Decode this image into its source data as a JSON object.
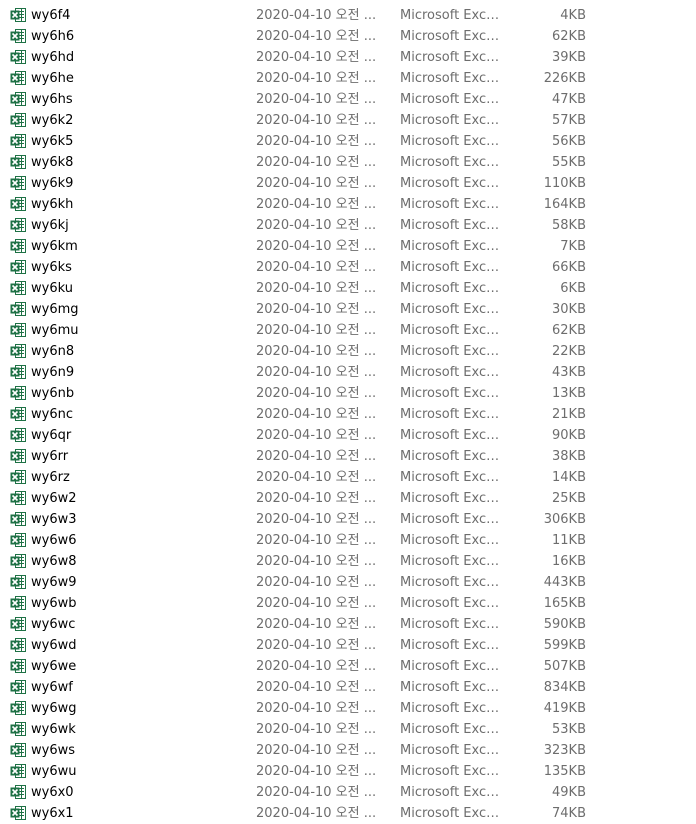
{
  "icon": "excel-file-icon",
  "colors": {
    "excel_green": "#1e7145",
    "secondary_text": "#6d6d6d"
  },
  "files": [
    {
      "name": "wy6f4",
      "date": "2020-04-10 오전 ...",
      "type": "Microsoft Excel...",
      "size": "4KB"
    },
    {
      "name": "wy6h6",
      "date": "2020-04-10 오전 ...",
      "type": "Microsoft Excel...",
      "size": "62KB"
    },
    {
      "name": "wy6hd",
      "date": "2020-04-10 오전 ...",
      "type": "Microsoft Excel...",
      "size": "39KB"
    },
    {
      "name": "wy6he",
      "date": "2020-04-10 오전 ...",
      "type": "Microsoft Excel...",
      "size": "226KB"
    },
    {
      "name": "wy6hs",
      "date": "2020-04-10 오전 ...",
      "type": "Microsoft Excel...",
      "size": "47KB"
    },
    {
      "name": "wy6k2",
      "date": "2020-04-10 오전 ...",
      "type": "Microsoft Excel...",
      "size": "57KB"
    },
    {
      "name": "wy6k5",
      "date": "2020-04-10 오전 ...",
      "type": "Microsoft Excel...",
      "size": "56KB"
    },
    {
      "name": "wy6k8",
      "date": "2020-04-10 오전 ...",
      "type": "Microsoft Excel...",
      "size": "55KB"
    },
    {
      "name": "wy6k9",
      "date": "2020-04-10 오전 ...",
      "type": "Microsoft Excel...",
      "size": "110KB"
    },
    {
      "name": "wy6kh",
      "date": "2020-04-10 오전 ...",
      "type": "Microsoft Excel...",
      "size": "164KB"
    },
    {
      "name": "wy6kj",
      "date": "2020-04-10 오전 ...",
      "type": "Microsoft Excel...",
      "size": "58KB"
    },
    {
      "name": "wy6km",
      "date": "2020-04-10 오전 ...",
      "type": "Microsoft Excel...",
      "size": "7KB"
    },
    {
      "name": "wy6ks",
      "date": "2020-04-10 오전 ...",
      "type": "Microsoft Excel...",
      "size": "66KB"
    },
    {
      "name": "wy6ku",
      "date": "2020-04-10 오전 ...",
      "type": "Microsoft Excel...",
      "size": "6KB"
    },
    {
      "name": "wy6mg",
      "date": "2020-04-10 오전 ...",
      "type": "Microsoft Excel...",
      "size": "30KB"
    },
    {
      "name": "wy6mu",
      "date": "2020-04-10 오전 ...",
      "type": "Microsoft Excel...",
      "size": "62KB"
    },
    {
      "name": "wy6n8",
      "date": "2020-04-10 오전 ...",
      "type": "Microsoft Excel...",
      "size": "22KB"
    },
    {
      "name": "wy6n9",
      "date": "2020-04-10 오전 ...",
      "type": "Microsoft Excel...",
      "size": "43KB"
    },
    {
      "name": "wy6nb",
      "date": "2020-04-10 오전 ...",
      "type": "Microsoft Excel...",
      "size": "13KB"
    },
    {
      "name": "wy6nc",
      "date": "2020-04-10 오전 ...",
      "type": "Microsoft Excel...",
      "size": "21KB"
    },
    {
      "name": "wy6qr",
      "date": "2020-04-10 오전 ...",
      "type": "Microsoft Excel...",
      "size": "90KB"
    },
    {
      "name": "wy6rr",
      "date": "2020-04-10 오전 ...",
      "type": "Microsoft Excel...",
      "size": "38KB"
    },
    {
      "name": "wy6rz",
      "date": "2020-04-10 오전 ...",
      "type": "Microsoft Excel...",
      "size": "14KB"
    },
    {
      "name": "wy6w2",
      "date": "2020-04-10 오전 ...",
      "type": "Microsoft Excel...",
      "size": "25KB"
    },
    {
      "name": "wy6w3",
      "date": "2020-04-10 오전 ...",
      "type": "Microsoft Excel...",
      "size": "306KB"
    },
    {
      "name": "wy6w6",
      "date": "2020-04-10 오전 ...",
      "type": "Microsoft Excel...",
      "size": "11KB"
    },
    {
      "name": "wy6w8",
      "date": "2020-04-10 오전 ...",
      "type": "Microsoft Excel...",
      "size": "16KB"
    },
    {
      "name": "wy6w9",
      "date": "2020-04-10 오전 ...",
      "type": "Microsoft Excel...",
      "size": "443KB"
    },
    {
      "name": "wy6wb",
      "date": "2020-04-10 오전 ...",
      "type": "Microsoft Excel...",
      "size": "165KB"
    },
    {
      "name": "wy6wc",
      "date": "2020-04-10 오전 ...",
      "type": "Microsoft Excel...",
      "size": "590KB"
    },
    {
      "name": "wy6wd",
      "date": "2020-04-10 오전 ...",
      "type": "Microsoft Excel...",
      "size": "599KB"
    },
    {
      "name": "wy6we",
      "date": "2020-04-10 오전 ...",
      "type": "Microsoft Excel...",
      "size": "507KB"
    },
    {
      "name": "wy6wf",
      "date": "2020-04-10 오전 ...",
      "type": "Microsoft Excel...",
      "size": "834KB"
    },
    {
      "name": "wy6wg",
      "date": "2020-04-10 오전 ...",
      "type": "Microsoft Excel...",
      "size": "419KB"
    },
    {
      "name": "wy6wk",
      "date": "2020-04-10 오전 ...",
      "type": "Microsoft Excel...",
      "size": "53KB"
    },
    {
      "name": "wy6ws",
      "date": "2020-04-10 오전 ...",
      "type": "Microsoft Excel...",
      "size": "323KB"
    },
    {
      "name": "wy6wu",
      "date": "2020-04-10 오전 ...",
      "type": "Microsoft Excel...",
      "size": "135KB"
    },
    {
      "name": "wy6x0",
      "date": "2020-04-10 오전 ...",
      "type": "Microsoft Excel...",
      "size": "49KB"
    },
    {
      "name": "wy6x1",
      "date": "2020-04-10 오전 ...",
      "type": "Microsoft Excel...",
      "size": "74KB"
    }
  ]
}
